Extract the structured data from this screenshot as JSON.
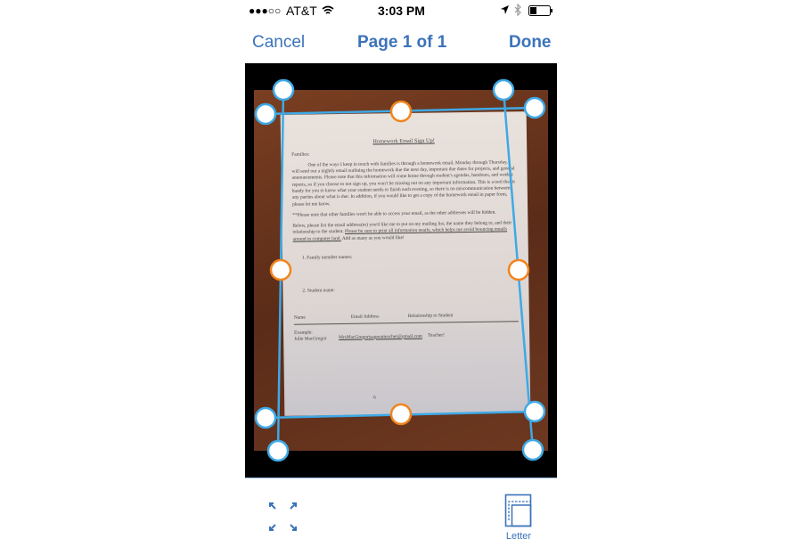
{
  "status_bar": {
    "signal": "●●●○○",
    "carrier": "AT&T",
    "time": "3:03 PM",
    "icons": [
      "wifi-icon",
      "location-icon",
      "bluetooth-icon",
      "battery-icon"
    ]
  },
  "nav": {
    "cancel": "Cancel",
    "title": "Page 1 of 1",
    "done": "Done"
  },
  "document": {
    "title": "Homework Email Sign Up!",
    "greeting": "Families:",
    "para1": "One of the ways I keep in touch with families is through a homework email. Monday through Thursday, I will send out a nightly email outlining the homework due the next day, important due dates for projects, and general announcements. Please note that this information will come home through student's agendas, handouts, and weekly reports, so if you choose to not sign up, you won't be missing out on any important information. This is a tool that is handy for you to know what your student needs to finish each evening, so there is no miscommunication between any parties about what is due. In addition, if you would like to get a copy of the homework email in paper form, please let me know.",
    "para2": "**Please note that other families won't be able to access your email, as the other addresses will be hidden.",
    "para3a": "Below, please list the email address(es) you'd like me to put on my mailing list, the name they belong to, and their relationship to the student. ",
    "para3b": "Please be sure to print all information neatly, which helps me avoid bouncing emails around in computer land.",
    "para3c": " Add as many as you would like!",
    "item1": "1.   Family member names:",
    "item2": "2.   Student name:",
    "col_name": "Name",
    "col_email": "Email Address",
    "col_rel": "Relationship to Student",
    "example_label": "Example:",
    "example_name": "Julie MacGregor",
    "example_email": "MrsMacGregorisagreatteacher@gmail.com",
    "example_rel": "Teacher!",
    "page_mark": "6"
  },
  "colors": {
    "accent": "#3b73b9",
    "crop_line": "#3fa9e6",
    "edge_handle": "#f0851e"
  },
  "bottom": {
    "letter_label": "Letter"
  }
}
